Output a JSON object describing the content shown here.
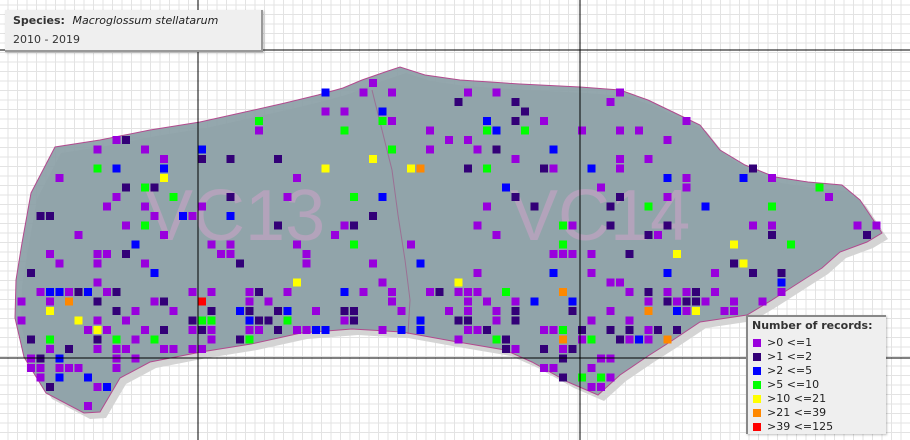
{
  "info": {
    "species_label": "Species:",
    "species_name": "Macroglossum stellatarum",
    "period": "2010 - 2019"
  },
  "map": {
    "region_labels": [
      "VC13",
      "VC14"
    ],
    "colors": {
      "land": "#8b9fa6",
      "land_edge": "#b24a8e",
      "shadow": "#d4d4d4",
      "fine_grid": "#e3e3e3",
      "major_grid": "#000000"
    }
  },
  "legend": {
    "title": "Number of records:",
    "items": [
      {
        "label": ">0 <=1",
        "color": "#9900dd"
      },
      {
        "label": ">1 <=2",
        "color": "#330077"
      },
      {
        "label": ">2 <=5",
        "color": "#0000ff"
      },
      {
        "label": ">5 <=10",
        "color": "#00ff00"
      },
      {
        "label": ">10 <=21",
        "color": "#ffff00"
      },
      {
        "label": ">21 <=39",
        "color": "#ff8800"
      },
      {
        "label": ">39 <=125",
        "color": "#ff0000"
      }
    ]
  }
}
